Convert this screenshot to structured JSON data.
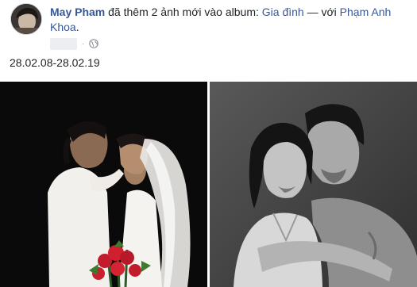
{
  "post": {
    "author": "May Pham",
    "action_text": " đã thêm 2 ảnh mới vào album: ",
    "album": "Gia đình",
    "with_text": " — với ",
    "tagged": "Phạm Anh Khoa",
    "end": ".",
    "caption": "28.02.08-28.02.19",
    "privacy_icon": "globe-icon",
    "photos": [
      "wedding-kiss-photo",
      "couple-portrait-photo"
    ]
  },
  "colors": {
    "link": "#365899",
    "text": "#1d2129",
    "muted": "#90949c"
  }
}
